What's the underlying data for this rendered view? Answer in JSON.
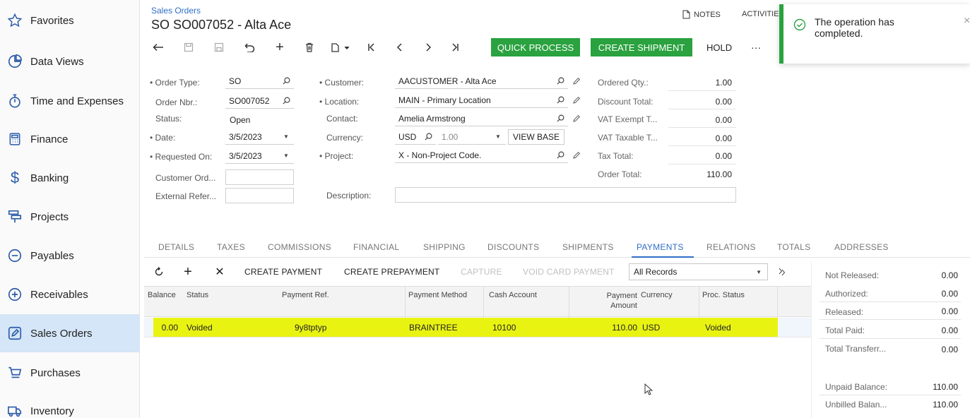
{
  "sidebar": {
    "items": [
      {
        "label": "Favorites",
        "icon": "star-icon"
      },
      {
        "label": "Data Views",
        "icon": "pie-chart-icon"
      },
      {
        "label": "Time and Expenses",
        "icon": "stopwatch-icon"
      },
      {
        "label": "Finance",
        "icon": "calculator-icon"
      },
      {
        "label": "Banking",
        "icon": "dollar-icon"
      },
      {
        "label": "Projects",
        "icon": "projects-icon"
      },
      {
        "label": "Payables",
        "icon": "minus-circle-icon"
      },
      {
        "label": "Receivables",
        "icon": "plus-circle-icon"
      },
      {
        "label": "Sales Orders",
        "icon": "edit-square-icon",
        "active": true
      },
      {
        "label": "Purchases",
        "icon": "cart-icon"
      },
      {
        "label": "Inventory",
        "icon": "truck-icon"
      }
    ]
  },
  "header": {
    "breadcrumb": "Sales Orders",
    "title": "SO SO007052 - Alta Ace",
    "notes": "NOTES",
    "activities": "ACTIVITIES"
  },
  "toolbar": {
    "quick_process": "QUICK PROCESS",
    "create_shipment": "CREATE SHIPMENT",
    "hold": "HOLD",
    "more": "···"
  },
  "toast": {
    "message": "The operation has completed.",
    "close": "×",
    "color": "#2aa23f"
  },
  "form": {
    "order_type": {
      "label": "Order Type:",
      "value": "SO"
    },
    "order_nbr": {
      "label": "Order Nbr.:",
      "value": "SO007052"
    },
    "status": {
      "label": "Status:",
      "value": "Open"
    },
    "date": {
      "label": "Date:",
      "value": "3/5/2023"
    },
    "requested_on": {
      "label": "Requested On:",
      "value": "3/5/2023"
    },
    "customer_ord": {
      "label": "Customer Ord...",
      "value": ""
    },
    "external_refer": {
      "label": "External Refer...",
      "value": ""
    },
    "customer": {
      "label": "Customer:",
      "value": "AACUSTOMER - Alta Ace"
    },
    "location": {
      "label": "Location:",
      "value": "MAIN - Primary Location"
    },
    "contact": {
      "label": "Contact:",
      "value": "Amelia Armstrong"
    },
    "currency": {
      "label": "Currency:",
      "value": "USD",
      "rate": "1.00",
      "view_base": "VIEW BASE"
    },
    "project": {
      "label": "Project:",
      "value": "X - Non-Project Code."
    },
    "description": {
      "label": "Description:",
      "value": ""
    }
  },
  "summary": [
    {
      "label": "Ordered Qty.:",
      "value": "1.00"
    },
    {
      "label": "Discount Total:",
      "value": "0.00"
    },
    {
      "label": "VAT Exempt T...",
      "value": "0.00"
    },
    {
      "label": "VAT Taxable T...",
      "value": "0.00"
    },
    {
      "label": "Tax Total:",
      "value": "0.00"
    },
    {
      "label": "Order Total:",
      "value": "110.00"
    }
  ],
  "tabs": [
    "DETAILS",
    "TAXES",
    "COMMISSIONS",
    "FINANCIAL",
    "SHIPPING",
    "DISCOUNTS",
    "SHIPMENTS",
    "PAYMENTS",
    "RELATIONS",
    "TOTALS",
    "ADDRESSES"
  ],
  "active_tab": "PAYMENTS",
  "grid_toolbar": {
    "create_payment": "CREATE PAYMENT",
    "create_prepayment": "CREATE PREPAYMENT",
    "capture": "CAPTURE",
    "void_card_payment": "VOID CARD PAYMENT",
    "filter": "All Records"
  },
  "grid": {
    "columns": [
      "Balance",
      "Status",
      "Payment Ref.",
      "Payment Method",
      "Cash Account",
      "Payment Amount",
      "Currency",
      "Proc. Status"
    ],
    "rows": [
      {
        "balance": "0.00",
        "status": "Voided",
        "payment_ref": "9y8tptyp",
        "payment_method": "BRAINTREE",
        "cash_account": "10100",
        "payment_amount": "110.00",
        "currency": "USD",
        "proc_status": "Voided"
      }
    ],
    "highlight_color": "#e9f312"
  },
  "payment_totals": [
    {
      "label": "Not Released:",
      "value": "0.00"
    },
    {
      "label": "Authorized:",
      "value": "0.00"
    },
    {
      "label": "Released:",
      "value": "0.00"
    },
    {
      "label": "Total Paid:",
      "value": "0.00"
    },
    {
      "label": "Total Transferr...",
      "value": "0.00"
    },
    {
      "label": "Unpaid Balance:",
      "value": "110.00"
    },
    {
      "label": "Unbilled Balan...",
      "value": "110.00"
    }
  ]
}
